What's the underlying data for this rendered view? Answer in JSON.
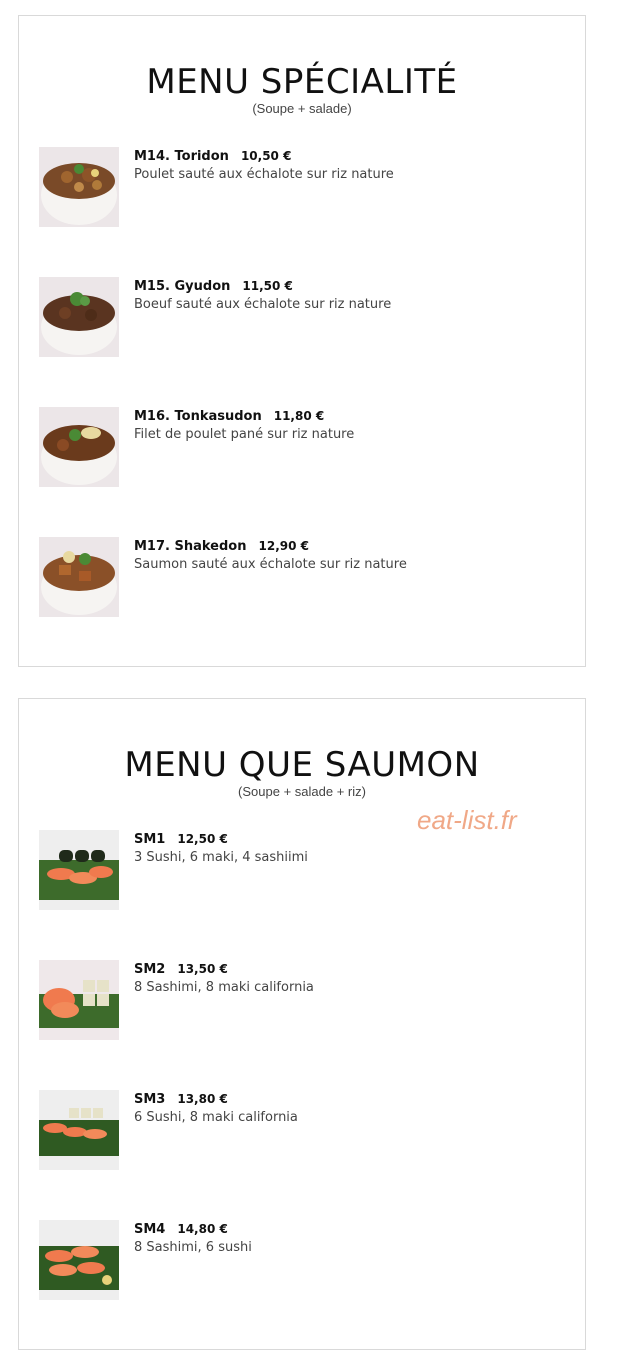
{
  "sections": [
    {
      "title": "MENU SPÉCIALITÉ",
      "subtitle": "(Soupe + salade)",
      "items": [
        {
          "name": "M14. Toridon",
          "price": "10,50 €",
          "desc": "Poulet sauté aux échalote sur riz nature",
          "image": "chicken-donburi-bowl"
        },
        {
          "name": "M15. Gyudon",
          "price": "11,50 €",
          "desc": "Boeuf sauté aux échalote sur riz nature",
          "image": "beef-donburi-bowl"
        },
        {
          "name": "M16. Tonkasudon",
          "price": "11,80 €",
          "desc": "Filet de poulet pané sur riz nature",
          "image": "breaded-chicken-bowl"
        },
        {
          "name": "M17. Shakedon",
          "price": "12,90 €",
          "desc": "Saumon sauté aux échalote sur riz nature",
          "image": "salmon-donburi-bowl"
        }
      ]
    },
    {
      "title": "MENU QUE SAUMON",
      "subtitle": "(Soupe + salade + riz)",
      "watermark": "eat-list.fr",
      "items": [
        {
          "name": "SM1",
          "price": "12,50 €",
          "desc": "3 Sushi, 6 maki, 4 sashiimi",
          "image": "salmon-sushi-maki-plate"
        },
        {
          "name": "SM2",
          "price": "13,50 €",
          "desc": "8 Sashimi, 8 maki california",
          "image": "sashimi-california-plate"
        },
        {
          "name": "SM3",
          "price": "13,80 €",
          "desc": "6 Sushi, 8 maki california",
          "image": "sushi-california-plate"
        },
        {
          "name": "SM4",
          "price": "14,80 €",
          "desc": "8 Sashimi, 6 sushi",
          "image": "sashimi-sushi-plate"
        }
      ]
    }
  ],
  "colors": {
    "border": "#d9d9d9",
    "watermark": "#f0a887",
    "bowl": "#f3f1ef",
    "rice_meat": "#6b3d1e",
    "salmon": "#f07a4e",
    "leaf": "#3d6b2b"
  }
}
